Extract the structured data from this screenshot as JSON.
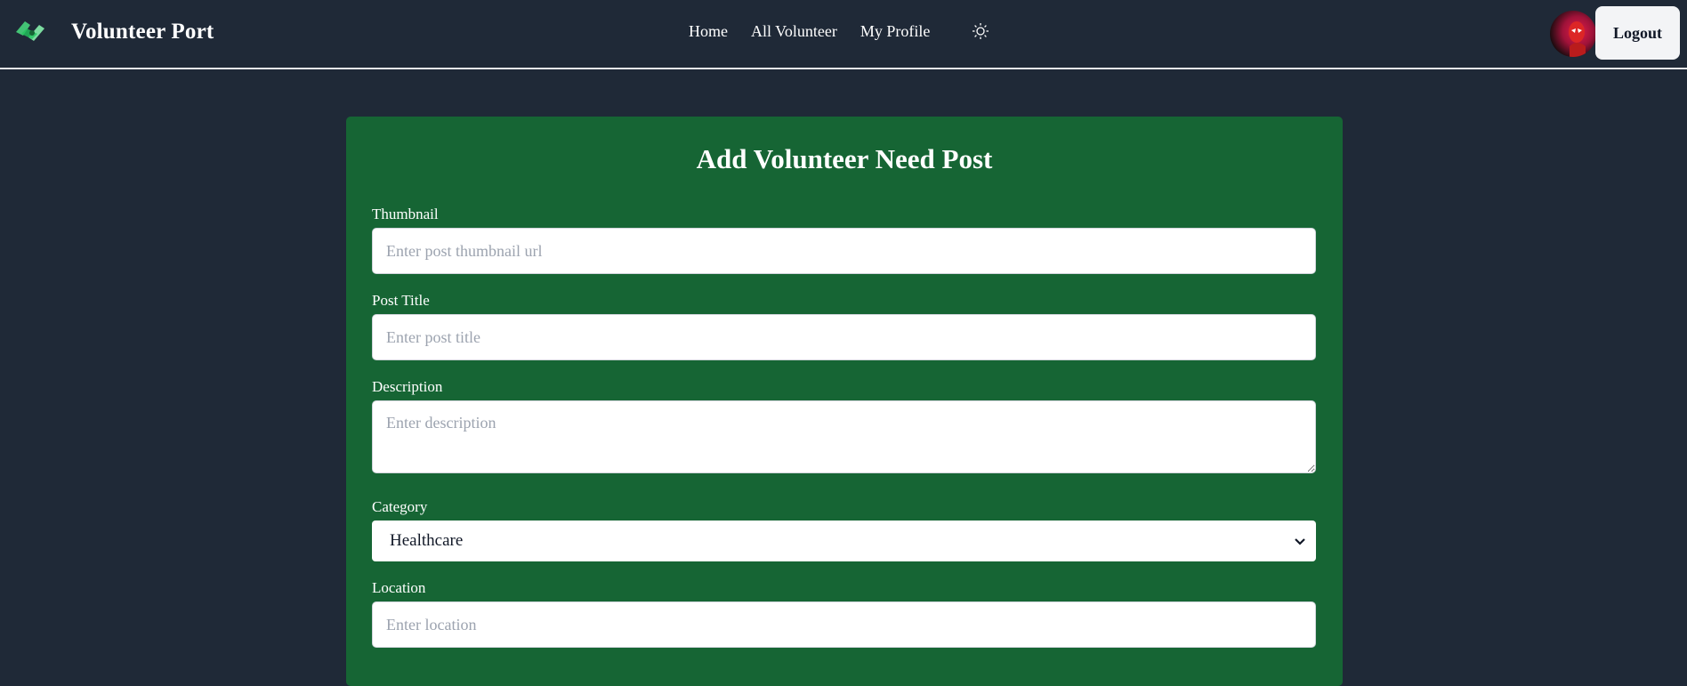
{
  "header": {
    "brand_title": "Volunteer Port",
    "nav": [
      {
        "label": "Home"
      },
      {
        "label": "All Volunteer"
      },
      {
        "label": "My Profile"
      }
    ],
    "theme_icon": "sun-icon",
    "logout_label": "Logout"
  },
  "form": {
    "title": "Add Volunteer Need Post",
    "thumbnail": {
      "label": "Thumbnail",
      "placeholder": "Enter post thumbnail url",
      "value": ""
    },
    "post_title": {
      "label": "Post Title",
      "placeholder": "Enter post title",
      "value": ""
    },
    "description": {
      "label": "Description",
      "placeholder": "Enter description",
      "value": ""
    },
    "category": {
      "label": "Category",
      "selected": "Healthcare"
    },
    "location": {
      "label": "Location",
      "placeholder": "Enter location",
      "value": ""
    }
  },
  "colors": {
    "page_bg": "#1f2937",
    "card_bg": "#166534",
    "text_light": "#ffffff",
    "button_bg": "#f3f4f6"
  }
}
